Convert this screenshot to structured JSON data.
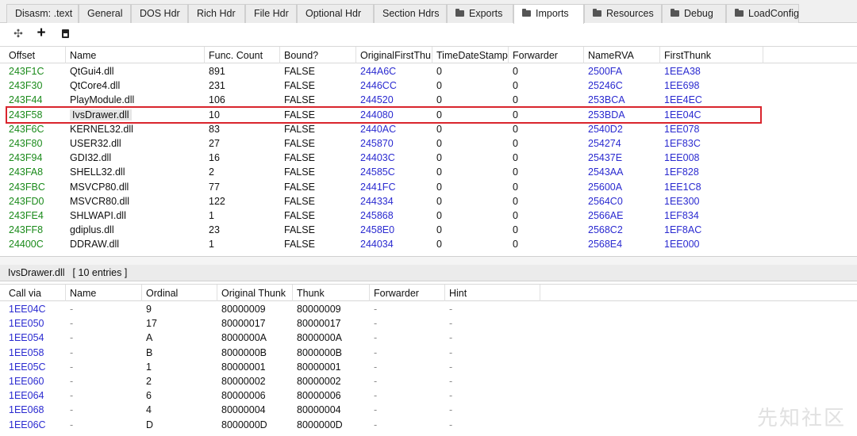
{
  "tabs": [
    {
      "label": "Disasm: .text",
      "folder": false
    },
    {
      "label": "General",
      "folder": false
    },
    {
      "label": "DOS Hdr",
      "folder": false
    },
    {
      "label": "Rich Hdr",
      "folder": false
    },
    {
      "label": "File Hdr",
      "folder": false
    },
    {
      "label": "Optional Hdr",
      "folder": false
    },
    {
      "label": "Section Hdrs",
      "folder": false
    },
    {
      "label": "Exports",
      "folder": true
    },
    {
      "label": "Imports",
      "folder": true,
      "active": true
    },
    {
      "label": "Resources",
      "folder": true
    },
    {
      "label": "Debug",
      "folder": true
    },
    {
      "label": "LoadConfig",
      "folder": true
    }
  ],
  "toolbar": {
    "icons": [
      "move-icon",
      "add-icon",
      "save-icon"
    ]
  },
  "imports_table": {
    "columns": [
      "Offset",
      "Name",
      "Func. Count",
      "Bound?",
      "OriginalFirstThu",
      "TimeDateStamp",
      "Forwarder",
      "NameRVA",
      "FirstThunk"
    ],
    "rows": [
      [
        "243F1C",
        "QtGui4.dll",
        "891",
        "FALSE",
        "244A6C",
        "0",
        "0",
        "2500FA",
        "1EEA38"
      ],
      [
        "243F30",
        "QtCore4.dll",
        "231",
        "FALSE",
        "2446CC",
        "0",
        "0",
        "25246C",
        "1EE698"
      ],
      [
        "243F44",
        "PlayModule.dll",
        "106",
        "FALSE",
        "244520",
        "0",
        "0",
        "253BCA",
        "1EE4EC"
      ],
      [
        "243F58",
        "IvsDrawer.dll",
        "10",
        "FALSE",
        "244080",
        "0",
        "0",
        "253BDA",
        "1EE04C"
      ],
      [
        "243F6C",
        "KERNEL32.dll",
        "83",
        "FALSE",
        "2440AC",
        "0",
        "0",
        "2540D2",
        "1EE078"
      ],
      [
        "243F80",
        "USER32.dll",
        "27",
        "FALSE",
        "245870",
        "0",
        "0",
        "254274",
        "1EF83C"
      ],
      [
        "243F94",
        "GDI32.dll",
        "16",
        "FALSE",
        "24403C",
        "0",
        "0",
        "25437E",
        "1EE008"
      ],
      [
        "243FA8",
        "SHELL32.dll",
        "2",
        "FALSE",
        "24585C",
        "0",
        "0",
        "2543AA",
        "1EF828"
      ],
      [
        "243FBC",
        "MSVCP80.dll",
        "77",
        "FALSE",
        "2441FC",
        "0",
        "0",
        "25600A",
        "1EE1C8"
      ],
      [
        "243FD0",
        "MSVCR80.dll",
        "122",
        "FALSE",
        "244334",
        "0",
        "0",
        "2564C0",
        "1EE300"
      ],
      [
        "243FE4",
        "SHLWAPI.dll",
        "1",
        "FALSE",
        "245868",
        "0",
        "0",
        "2566AE",
        "1EF834"
      ],
      [
        "243FF8",
        "gdiplus.dll",
        "23",
        "FALSE",
        "2458E0",
        "0",
        "0",
        "2568C2",
        "1EF8AC"
      ],
      [
        "24400C",
        "DDRAW.dll",
        "1",
        "FALSE",
        "244034",
        "0",
        "0",
        "2568E4",
        "1EE000"
      ]
    ],
    "selected_index": 3
  },
  "detail": {
    "dll": "IvsDrawer.dll",
    "entries": "[ 10 entries ]",
    "columns": [
      "Call via",
      "Name",
      "Ordinal",
      "Original Thunk",
      "Thunk",
      "Forwarder",
      "Hint"
    ],
    "rows": [
      [
        "1EE04C",
        "-",
        "9",
        "80000009",
        "80000009",
        "-",
        "-"
      ],
      [
        "1EE050",
        "-",
        "17",
        "80000017",
        "80000017",
        "-",
        "-"
      ],
      [
        "1EE054",
        "-",
        "A",
        "8000000A",
        "8000000A",
        "-",
        "-"
      ],
      [
        "1EE058",
        "-",
        "B",
        "8000000B",
        "8000000B",
        "-",
        "-"
      ],
      [
        "1EE05C",
        "-",
        "1",
        "80000001",
        "80000001",
        "-",
        "-"
      ],
      [
        "1EE060",
        "-",
        "2",
        "80000002",
        "80000002",
        "-",
        "-"
      ],
      [
        "1EE064",
        "-",
        "6",
        "80000006",
        "80000006",
        "-",
        "-"
      ],
      [
        "1EE068",
        "-",
        "4",
        "80000004",
        "80000004",
        "-",
        "-"
      ],
      [
        "1EE06C",
        "-",
        "D",
        "8000000D",
        "8000000D",
        "-",
        "-"
      ]
    ]
  },
  "watermark": "先知社区",
  "colors": {
    "offset_green": "#1a8a1a",
    "rva_blue": "#2a2ad0",
    "selection_red": "#d9252d"
  }
}
